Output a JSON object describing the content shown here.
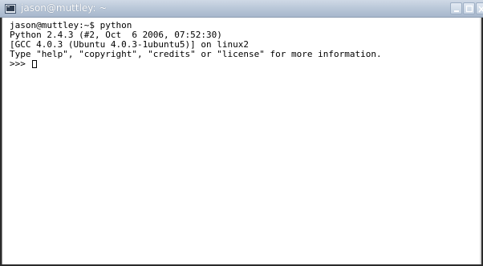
{
  "window": {
    "title": "jason@muttley: ~",
    "icon": "terminal-icon",
    "controls": [
      "minimize",
      "maximize",
      "close"
    ]
  },
  "terminal": {
    "lines": [
      "jason@muttley:~$ python",
      "Python 2.4.3 (#2, Oct  6 2006, 07:52:30)",
      "[GCC 4.0.3 (Ubuntu 4.0.3-1ubuntu5)] on linux2",
      "Type \"help\", \"copyright\", \"credits\" or \"license\" for more information."
    ],
    "prompt": ">>> "
  },
  "colors": {
    "titlebar": "#b9c7d8",
    "terminal_bg": "#ffffff",
    "text": "#000000"
  }
}
